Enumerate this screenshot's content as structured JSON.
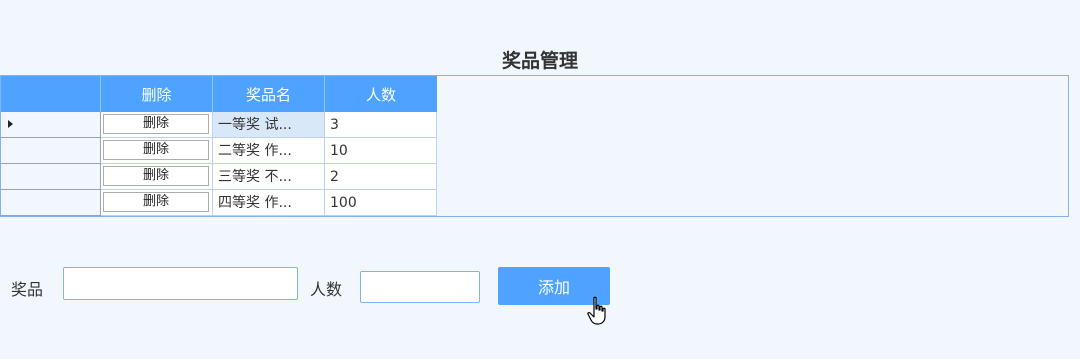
{
  "page": {
    "title": "奖品管理"
  },
  "grid": {
    "columns": [
      "删除",
      "奖品名",
      "人数"
    ],
    "rows": [
      {
        "delete_label": "删除",
        "name": "一等奖 试...",
        "count": "3",
        "current": true
      },
      {
        "delete_label": "删除",
        "name": "二等奖 作...",
        "count": "10",
        "current": false
      },
      {
        "delete_label": "删除",
        "name": "三等奖 不...",
        "count": "2",
        "current": false
      },
      {
        "delete_label": "删除",
        "name": "四等奖 作...",
        "count": "100",
        "current": false
      }
    ]
  },
  "form": {
    "prize_label": "奖品",
    "prize_value": "",
    "count_label": "人数",
    "count_value": "",
    "add_label": "添加"
  },
  "colors": {
    "header_bg": "#4da3ff",
    "button_bg": "#4da3ff",
    "page_bg": "#f2f7fd",
    "border": "#7eb3ee"
  },
  "icons": {
    "row_indicator": "current-row-arrow-icon",
    "cursor": "hand-pointer-icon"
  }
}
